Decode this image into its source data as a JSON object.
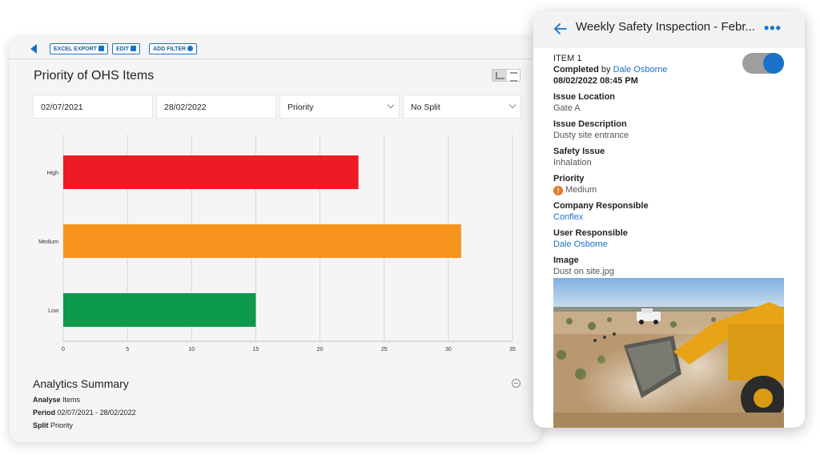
{
  "analytics": {
    "toolbar": {
      "excel_export": "EXCEL EXPORT",
      "edit": "EDIT",
      "add_filter": "ADD FILTER"
    },
    "title": "Priority of OHS Items",
    "filters": {
      "start_date": "02/07/2021",
      "end_date": "28/02/2022",
      "group_by": "Priority",
      "split": "No Split"
    },
    "summary": {
      "title": "Analytics Summary",
      "analyse_label": "Analyse",
      "analyse_value": "Items",
      "period_label": "Period",
      "period_value": "02/07/2021 - 28/02/2022",
      "split_label": "Split",
      "split_value": "Priority"
    }
  },
  "chart_data": {
    "type": "bar",
    "orientation": "horizontal",
    "categories": [
      "High",
      "Medium",
      "Low"
    ],
    "values": [
      23,
      31,
      15
    ],
    "colors": [
      "#ed1c24",
      "#f7941d",
      "#0d9a4a"
    ],
    "xlim": [
      0,
      35
    ],
    "xticks": [
      0,
      5,
      10,
      15,
      20,
      25,
      30,
      35
    ],
    "grid": true,
    "title": "",
    "xlabel": "",
    "ylabel": ""
  },
  "inspection": {
    "title": "Weekly Safety Inspection - Febr...",
    "item_no": "ITEM 1",
    "completed_label": "Completed",
    "completed_by_word": "by",
    "completed_by": "Dale Osborne",
    "completed_at": "08/02/2022 08:45 PM",
    "toggle_on": true,
    "fields": [
      {
        "label": "Issue Location",
        "value": "Gate A",
        "link": false
      },
      {
        "label": "Issue Description",
        "value": "Dusty site entrance",
        "link": false
      },
      {
        "label": "Safety Issue",
        "value": "Inhalation",
        "link": false
      },
      {
        "label": "Priority",
        "value": "Medium",
        "link": false,
        "icon": "warning-icon"
      },
      {
        "label": "Company Responsible",
        "value": "Conflex",
        "link": true
      },
      {
        "label": "User Responsible",
        "value": "Dale Osborne",
        "link": true
      },
      {
        "label": "Image",
        "value": "Dust on site.jpg",
        "link": false
      }
    ],
    "accent": "#1a73c8"
  }
}
